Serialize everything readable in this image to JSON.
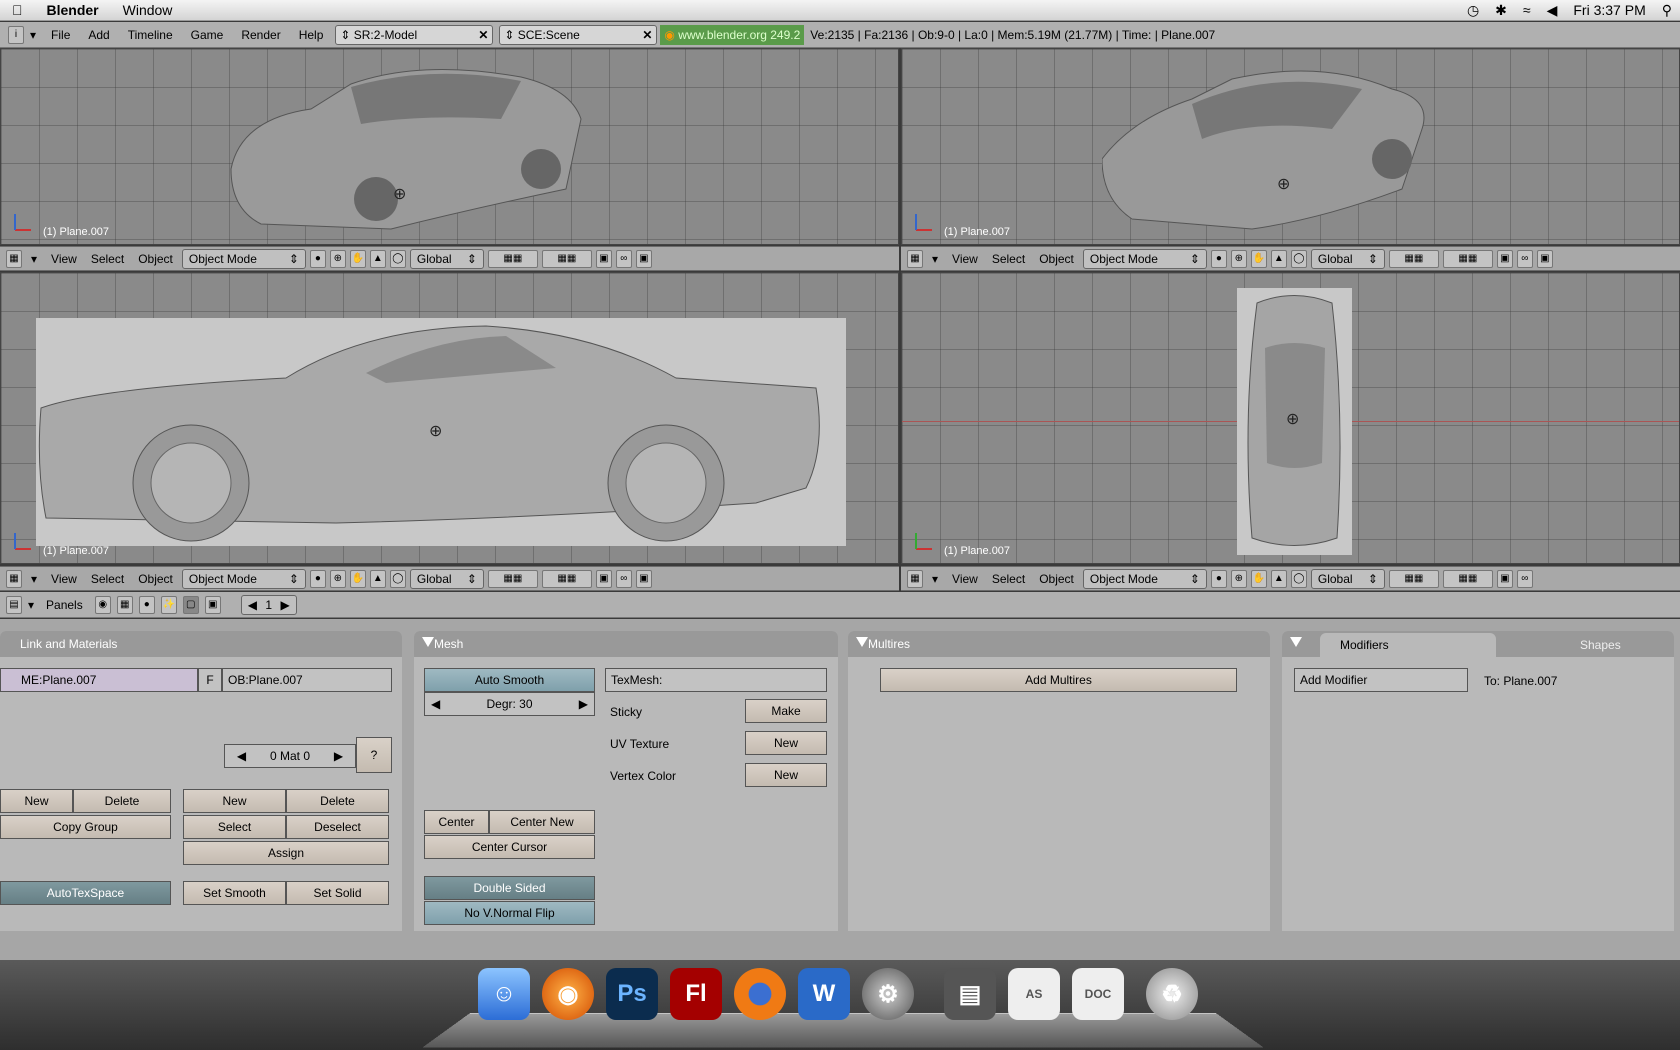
{
  "macbar": {
    "app_name": "Blender",
    "window_menu": "Window",
    "clock": "Fri 3:37 PM",
    "icons": [
      "apple-icon",
      "time-machine-icon",
      "bluetooth-icon",
      "wifi-icon",
      "volume-icon",
      "spotlight-icon"
    ]
  },
  "topbar": {
    "menus": [
      "File",
      "Add",
      "Timeline",
      "Game",
      "Render",
      "Help"
    ],
    "screen": "SR:2-Model",
    "scene": "SCE:Scene",
    "url": "www.blender.org 249.2",
    "stats": "Ve:2135 | Fa:2136 | Ob:9-0 | La:0  | Mem:5.19M (21.77M)  | Time: | Plane.007"
  },
  "viewport_label": "(1) Plane.007",
  "vheader": {
    "view": "View",
    "select": "Select",
    "object": "Object",
    "mode": "Object Mode",
    "orientation": "Global"
  },
  "buttons_bar": {
    "panels_label": "Panels",
    "frame": "1"
  },
  "link_materials": {
    "title": "Link and Materials",
    "mesh_name": "ME:Plane.007",
    "f_label": "F",
    "object_name": "OB:Plane.007",
    "mat_counter": "0 Mat 0",
    "question": "?",
    "new": "New",
    "delete": "Delete",
    "copy_group": "Copy Group",
    "new2": "New",
    "delete2": "Delete",
    "select": "Select",
    "deselect": "Deselect",
    "assign": "Assign",
    "autotexspace": "AutoTexSpace",
    "set_smooth": "Set Smooth",
    "set_solid": "Set Solid"
  },
  "mesh": {
    "title": "Mesh",
    "auto_smooth": "Auto Smooth",
    "degr": "Degr: 30",
    "texmesh": "TexMesh:",
    "sticky": "Sticky",
    "make": "Make",
    "uv_texture": "UV Texture",
    "new_uv": "New",
    "vertex_color": "Vertex Color",
    "new_vc": "New",
    "center": "Center",
    "center_new": "Center New",
    "center_cursor": "Center Cursor",
    "double_sided": "Double Sided",
    "no_vnormal_flip": "No V.Normal Flip"
  },
  "multires": {
    "title": "Multires",
    "add_multires": "Add Multires"
  },
  "modifiers": {
    "tab_modifiers": "Modifiers",
    "tab_shapes": "Shapes",
    "add_modifier": "Add Modifier",
    "to_label": "To: Plane.007"
  },
  "dock": {
    "items": [
      "Finder",
      "Firefox",
      "Ps",
      "Fl",
      "Blender",
      "Word",
      "System Preferences",
      "Folder",
      "AS",
      "DOC",
      "Trash"
    ]
  }
}
